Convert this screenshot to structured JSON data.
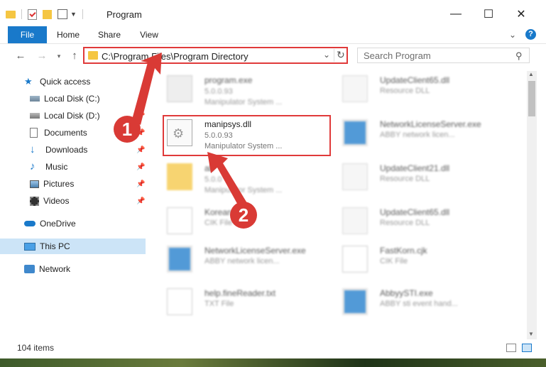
{
  "window": {
    "title": "Program",
    "minimize": "—",
    "maximize": "☐",
    "close": "✕"
  },
  "ribbon": {
    "tabs": [
      "File",
      "Home",
      "Share",
      "View"
    ],
    "help": "?",
    "expand": "⌄"
  },
  "address": {
    "path": "C:\\Program Files\\Program Directory",
    "refresh": "↻"
  },
  "search": {
    "placeholder": "Search Program"
  },
  "nav": {
    "items": [
      {
        "label": "Quick access",
        "icon": "star-icon"
      },
      {
        "label": "Local Disk (C:)",
        "icon": "drive-icon"
      },
      {
        "label": "Local Disk (D:)",
        "icon": "drive-icon"
      },
      {
        "label": "Documents",
        "icon": "documents-icon"
      },
      {
        "label": "Downloads",
        "icon": "download-icon"
      },
      {
        "label": "Music",
        "icon": "music-icon"
      },
      {
        "label": "Pictures",
        "icon": "pictures-icon"
      },
      {
        "label": "Videos",
        "icon": "videos-icon"
      },
      {
        "label": "OneDrive",
        "icon": "cloud-icon"
      },
      {
        "label": "This PC",
        "icon": "computer-icon"
      },
      {
        "label": "Network",
        "icon": "network-icon"
      }
    ]
  },
  "files": [
    {
      "name": "program.exe",
      "version": "5.0.0.93",
      "desc": "Manipulator System ..."
    },
    {
      "name": "UpdateClient65.dll",
      "version": "",
      "desc": "Resource DLL"
    },
    {
      "name": "manipsys.dll",
      "version": "5.0.0.93",
      "desc": "Manipulator System ..."
    },
    {
      "name": "NetworkLicenseServer.exe",
      "version": "",
      "desc": "ABBY network licen..."
    },
    {
      "name": "ab",
      "version": "5.0.0",
      "desc": "Manipulator System ..."
    },
    {
      "name": "UpdateClient21.dll",
      "version": "",
      "desc": "Resource DLL"
    },
    {
      "name": "Korean",
      "version": "",
      "desc": "CIK File"
    },
    {
      "name": "UpdateClient65.dll",
      "version": "",
      "desc": "Resource DLL"
    },
    {
      "name": "NetworkLicenseServer.exe",
      "version": "",
      "desc": "ABBY network licen..."
    },
    {
      "name": "FastKorn.cjk",
      "version": "",
      "desc": "CIK File"
    },
    {
      "name": "help.fineReader.txt",
      "version": "",
      "desc": "TXT File"
    },
    {
      "name": "AbbyySTI.exe",
      "version": "",
      "desc": "ABBY sti event hand..."
    }
  ],
  "status": {
    "count": "104 items"
  },
  "annotations": {
    "step1": "1",
    "step2": "2"
  },
  "colors": {
    "accent": "#1979ca",
    "highlight": "#e03a3a",
    "selected": "#cce4f7"
  }
}
